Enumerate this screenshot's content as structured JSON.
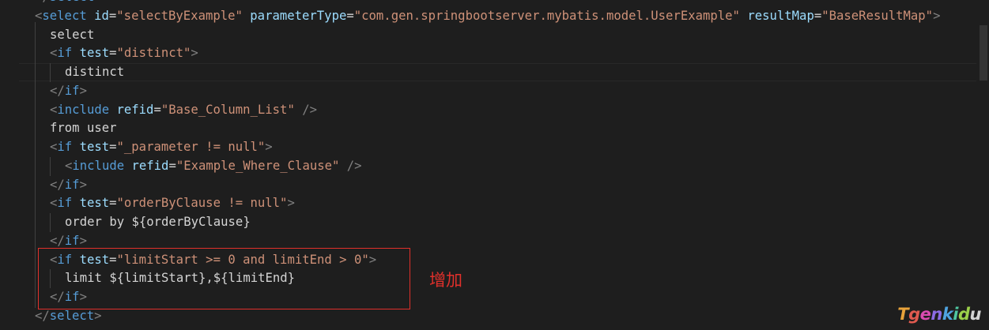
{
  "editor": {
    "lines": [
      {
        "parts": [
          {
            "t": "</",
            "c": "punc"
          },
          {
            "t": "select",
            "c": "tag"
          },
          {
            "t": ">",
            "c": "punc"
          }
        ]
      },
      {
        "parts": [
          {
            "t": "<",
            "c": "punc"
          },
          {
            "t": "select",
            "c": "tag"
          },
          {
            "t": " ",
            "c": "txt"
          },
          {
            "t": "id",
            "c": "attr"
          },
          {
            "t": "=",
            "c": "txt"
          },
          {
            "t": "\"selectByExample\"",
            "c": "str"
          },
          {
            "t": " ",
            "c": "txt"
          },
          {
            "t": "parameterType",
            "c": "attr"
          },
          {
            "t": "=",
            "c": "txt"
          },
          {
            "t": "\"com.gen.springbootserver.mybatis.model.UserExample\"",
            "c": "str"
          },
          {
            "t": " ",
            "c": "txt"
          },
          {
            "t": "resultMap",
            "c": "attr"
          },
          {
            "t": "=",
            "c": "txt"
          },
          {
            "t": "\"BaseResultMap\"",
            "c": "str"
          },
          {
            "t": ">",
            "c": "punc"
          }
        ]
      },
      {
        "parts": [
          {
            "t": "select",
            "c": "txt"
          }
        ]
      },
      {
        "parts": [
          {
            "t": "<",
            "c": "punc"
          },
          {
            "t": "if",
            "c": "tag"
          },
          {
            "t": " ",
            "c": "txt"
          },
          {
            "t": "test",
            "c": "attr"
          },
          {
            "t": "=",
            "c": "txt"
          },
          {
            "t": "\"distinct\"",
            "c": "str"
          },
          {
            "t": ">",
            "c": "punc"
          }
        ]
      },
      {
        "parts": [
          {
            "t": "distinct",
            "c": "txt"
          }
        ]
      },
      {
        "parts": [
          {
            "t": "</",
            "c": "punc"
          },
          {
            "t": "if",
            "c": "tag"
          },
          {
            "t": ">",
            "c": "punc"
          }
        ]
      },
      {
        "parts": [
          {
            "t": "<",
            "c": "punc"
          },
          {
            "t": "include",
            "c": "tag"
          },
          {
            "t": " ",
            "c": "txt"
          },
          {
            "t": "refid",
            "c": "attr"
          },
          {
            "t": "=",
            "c": "txt"
          },
          {
            "t": "\"Base_Column_List\"",
            "c": "str"
          },
          {
            "t": " />",
            "c": "punc"
          }
        ]
      },
      {
        "parts": [
          {
            "t": "from user",
            "c": "txt"
          }
        ]
      },
      {
        "parts": [
          {
            "t": "<",
            "c": "punc"
          },
          {
            "t": "if",
            "c": "tag"
          },
          {
            "t": " ",
            "c": "txt"
          },
          {
            "t": "test",
            "c": "attr"
          },
          {
            "t": "=",
            "c": "txt"
          },
          {
            "t": "\"_parameter != null\"",
            "c": "str"
          },
          {
            "t": ">",
            "c": "punc"
          }
        ]
      },
      {
        "parts": [
          {
            "t": "<",
            "c": "punc"
          },
          {
            "t": "include",
            "c": "tag"
          },
          {
            "t": " ",
            "c": "txt"
          },
          {
            "t": "refid",
            "c": "attr"
          },
          {
            "t": "=",
            "c": "txt"
          },
          {
            "t": "\"Example_Where_Clause\"",
            "c": "str"
          },
          {
            "t": " />",
            "c": "punc"
          }
        ]
      },
      {
        "parts": [
          {
            "t": "</",
            "c": "punc"
          },
          {
            "t": "if",
            "c": "tag"
          },
          {
            "t": ">",
            "c": "punc"
          }
        ]
      },
      {
        "parts": [
          {
            "t": "<",
            "c": "punc"
          },
          {
            "t": "if",
            "c": "tag"
          },
          {
            "t": " ",
            "c": "txt"
          },
          {
            "t": "test",
            "c": "attr"
          },
          {
            "t": "=",
            "c": "txt"
          },
          {
            "t": "\"orderByClause != null\"",
            "c": "str"
          },
          {
            "t": ">",
            "c": "punc"
          }
        ]
      },
      {
        "parts": [
          {
            "t": "order by ${orderByClause}",
            "c": "txt"
          }
        ]
      },
      {
        "parts": [
          {
            "t": "</",
            "c": "punc"
          },
          {
            "t": "if",
            "c": "tag"
          },
          {
            "t": ">",
            "c": "punc"
          }
        ]
      },
      {
        "parts": [
          {
            "t": "<",
            "c": "punc"
          },
          {
            "t": "if",
            "c": "tag"
          },
          {
            "t": " ",
            "c": "txt"
          },
          {
            "t": "test",
            "c": "attr"
          },
          {
            "t": "=",
            "c": "txt"
          },
          {
            "t": "\"limitStart >= 0 and limitEnd > 0\"",
            "c": "str"
          },
          {
            "t": ">",
            "c": "punc"
          }
        ]
      },
      {
        "parts": [
          {
            "t": "limit ${limitStart},${limitEnd}",
            "c": "txt"
          }
        ]
      },
      {
        "parts": [
          {
            "t": "</",
            "c": "punc"
          },
          {
            "t": "if",
            "c": "tag"
          },
          {
            "t": ">",
            "c": "punc"
          }
        ]
      },
      {
        "parts": [
          {
            "t": "</",
            "c": "punc"
          },
          {
            "t": "select",
            "c": "tag"
          },
          {
            "t": ">",
            "c": "punc"
          }
        ]
      }
    ]
  },
  "annotation": {
    "label": "增加"
  },
  "watermark": {
    "text": "Tgenkidu"
  },
  "colors": {
    "tag": "#569cd6",
    "attr": "#9cdcfe",
    "str": "#ce9178",
    "txt": "#d4d4d4",
    "punc": "#808080",
    "highlight": "#e0302b"
  }
}
